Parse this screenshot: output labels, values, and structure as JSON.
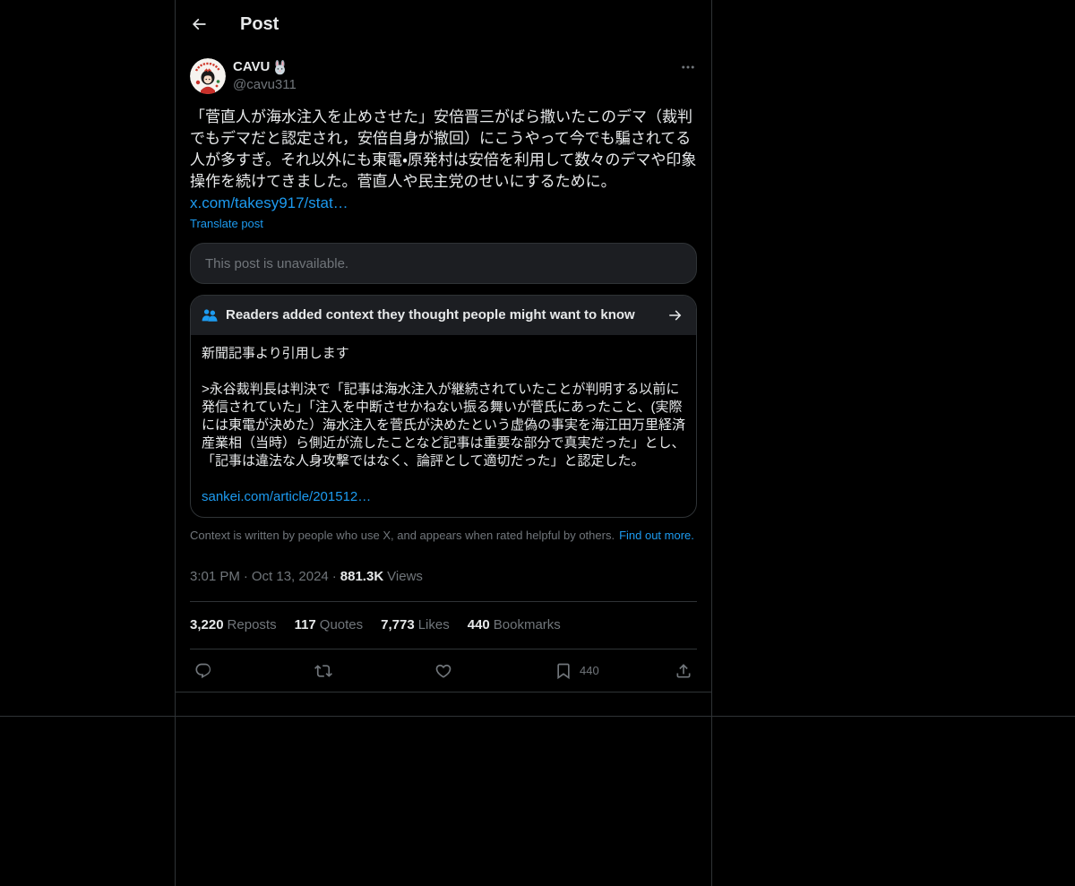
{
  "colors": {
    "background": "#000000",
    "text": "#e7e9ea",
    "muted": "#71767b",
    "accent": "#1d9bf0",
    "border": "#2f3336",
    "card": "#1c1e22"
  },
  "header": {
    "back_icon": "arrow-left-icon",
    "title": "Post"
  },
  "author": {
    "avatar_icon": "avatar",
    "name": "CAVU",
    "name_emoji_icon": "rabbit-face-emoji",
    "handle": "@cavu311",
    "more_icon": "more-dots-icon"
  },
  "post": {
    "text": "「菅直人が海水注入を止めさせた」安倍晋三がばら撒いたこのデマ（裁判でもデマだと認定され，安倍自身が撤回）にこうやって今でも騙されてる人が多すぎ。それ以外にも東電・原発村は安倍を利用して数々のデマや印象操作を続けてきました。菅直人や民主党のせいにするために。",
    "link": "x.com/takesy917/stat…",
    "translate_label": "Translate post"
  },
  "quoted_post": {
    "unavailable_text": "This post is unavailable."
  },
  "community_note": {
    "header_icon": "people-icon",
    "title": "Readers added context they thought people might want to know",
    "arrow_icon": "arrow-right-icon",
    "paragraphs": [
      "新聞記事より引用します",
      ">永谷裁判長は判決で「記事は海水注入が継続されていたことが判明する以前に発信されていた」「注入を中断させかねない振る舞いが菅氏にあったこと、(実際には東電が決めた）海水注入を菅氏が決めたという虚偽の事実を海江田万里経済産業相（当時）ら側近が流したことなど記事は重要な部分で真実だった」とし、「記事は違法な人身攻撃ではなく、論評として適切だった」と認定した。"
    ],
    "link": "sankei.com/article/201512…",
    "disclaimer": "Context is written by people who use X, and appears when rated helpful by others.",
    "find_out_more": "Find out more."
  },
  "meta": {
    "time": "3:01 PM",
    "separator": "·",
    "date": "Oct 13, 2024",
    "views_count": "881.3K",
    "views_label": "Views"
  },
  "stats": [
    {
      "count": "3,220",
      "label": "Reposts"
    },
    {
      "count": "117",
      "label": "Quotes"
    },
    {
      "count": "7,773",
      "label": "Likes"
    },
    {
      "count": "440",
      "label": "Bookmarks"
    }
  ],
  "actions": {
    "reply_icon": "reply-icon",
    "repost_icon": "repost-icon",
    "like_icon": "heart-icon",
    "bookmark_icon": "bookmark-icon",
    "bookmark_count": "440",
    "share_icon": "share-icon"
  }
}
